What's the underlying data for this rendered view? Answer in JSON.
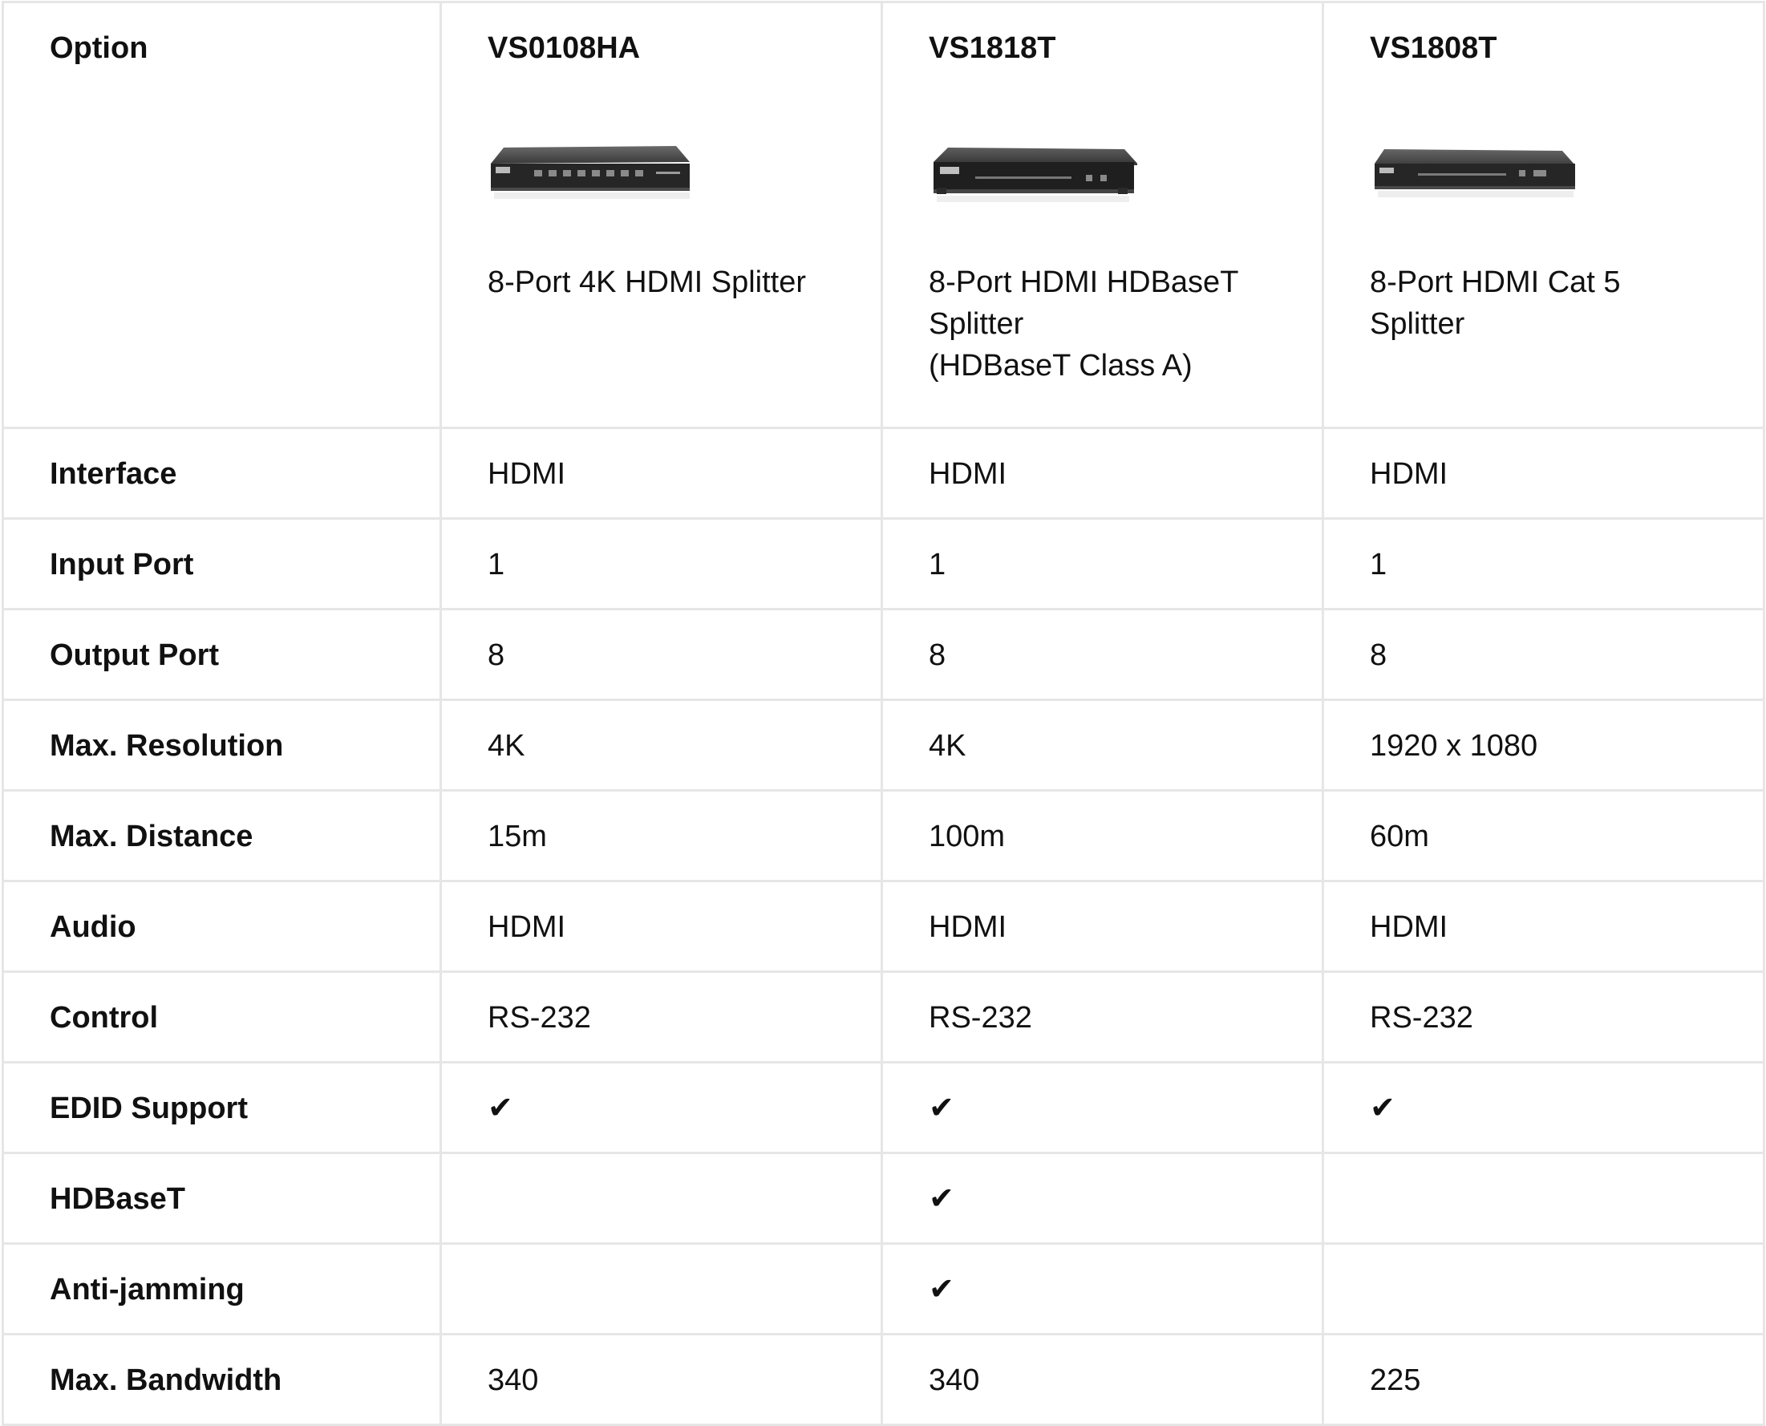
{
  "header": {
    "option_label": "Option",
    "products": [
      {
        "model": "VS0108HA",
        "description": "8-Port 4K HDMI Splitter",
        "image_icon": "hdmi-splitter-device-icon"
      },
      {
        "model": "VS1818T",
        "description": "8-Port HDMI HDBaseT\nSplitter\n(HDBaseT Class A)",
        "image_icon": "hdbaset-splitter-device-icon"
      },
      {
        "model": "VS1808T",
        "description": "8-Port HDMI Cat 5\nSplitter",
        "image_icon": "cat5-splitter-device-icon"
      }
    ]
  },
  "rows": [
    {
      "label": "Interface",
      "values": [
        "HDMI",
        "HDMI",
        "HDMI"
      ]
    },
    {
      "label": "Input Port",
      "values": [
        "1",
        "1",
        "1"
      ]
    },
    {
      "label": "Output Port",
      "values": [
        "8",
        "8",
        "8"
      ]
    },
    {
      "label": "Max. Resolution",
      "values": [
        "4K",
        "4K",
        "1920 x 1080"
      ]
    },
    {
      "label": "Max. Distance",
      "values": [
        "15m",
        "100m",
        "60m"
      ]
    },
    {
      "label": "Audio",
      "values": [
        "HDMI",
        "HDMI",
        "HDMI"
      ]
    },
    {
      "label": "Control",
      "values": [
        "RS-232",
        "RS-232",
        "RS-232"
      ]
    },
    {
      "label": "EDID Support",
      "values": [
        "✔",
        "✔",
        "✔"
      ]
    },
    {
      "label": "HDBaseT",
      "values": [
        "",
        "✔",
        ""
      ]
    },
    {
      "label": "Anti-jamming",
      "values": [
        "",
        "✔",
        ""
      ]
    },
    {
      "label": "Max. Bandwidth",
      "values": [
        "340",
        "340",
        "225"
      ]
    }
  ],
  "colors": {
    "text": "#111111",
    "grid": "#e6e6e6",
    "device_body": "#2b2b2b"
  }
}
